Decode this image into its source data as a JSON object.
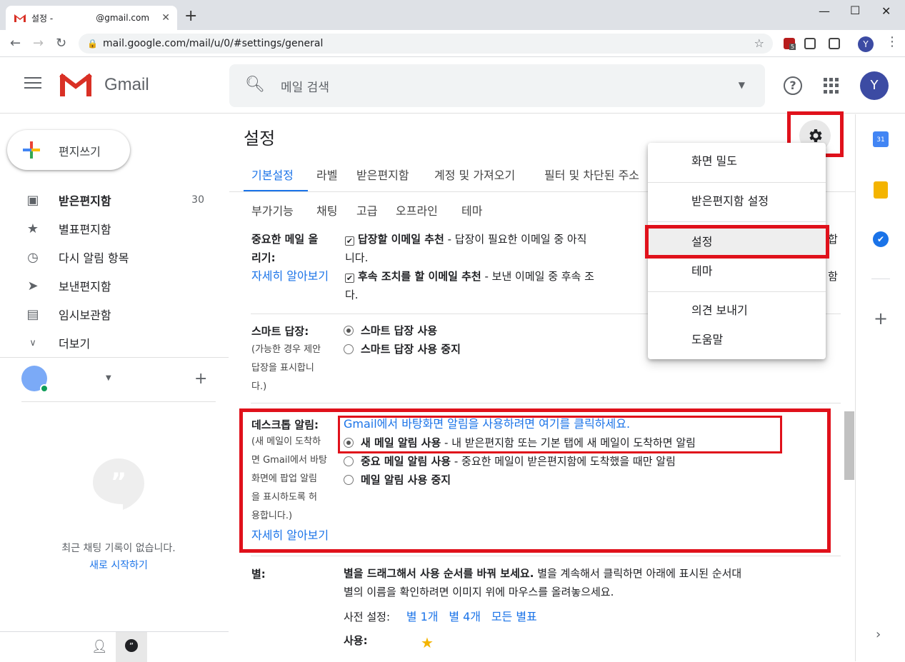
{
  "browser": {
    "tab_title": "설정 -",
    "tab_email": "@gmail.com",
    "url": "mail.google.com/mail/u/0/#settings/general",
    "profile_initial": "Y",
    "ext_badge": "5"
  },
  "gmail": {
    "logo_text": "Gmail",
    "search_placeholder": "메일 검색",
    "avatar_initial": "Y",
    "compose_label": "편지쓰기"
  },
  "sidebar": {
    "items": [
      {
        "label": "받은편지함",
        "count": "30",
        "icon": "inbox-icon",
        "bold": true
      },
      {
        "label": "별표편지함",
        "count": "",
        "icon": "star-icon"
      },
      {
        "label": "다시 알림 항목",
        "count": "",
        "icon": "clock-icon"
      },
      {
        "label": "보낸편지함",
        "count": "",
        "icon": "send-icon"
      },
      {
        "label": "임시보관함",
        "count": "",
        "icon": "draft-icon"
      },
      {
        "label": "더보기",
        "count": "",
        "icon": "chevron-down-icon"
      }
    ],
    "chat_empty": "최근 채팅 기록이 없습니다.",
    "chat_start": "새로 시작하기"
  },
  "settings": {
    "title": "설정",
    "tabs_row1": [
      "기본설정",
      "라벨",
      "받은편지함",
      "계정 및 가져오기",
      "필터 및 차단된 주소"
    ],
    "tabs_row2": [
      "부가기능",
      "채팅",
      "고급",
      "오프라인",
      "테마"
    ],
    "nudge": {
      "label_line1": "중요한 메일 올",
      "label_line2": "리기:",
      "learn_more": "자세히 알아보기",
      "opt1_bold": "답장할 이메일 추천",
      "opt1_rest": " - 답장이 필요한 이메일 중 아직",
      "opt1_tail": "합",
      "opt1_line2": "니다.",
      "opt2_bold": "후속 조치를 할 이메일 추천",
      "opt2_rest": " - 보낸 이메일 중 후속 조",
      "opt2_tail": "함",
      "opt2_line2": "다."
    },
    "smart_reply": {
      "label": "스마트 답장:",
      "desc": [
        "(가능한 경우 제안",
        "답장을 표시합니",
        "다.)"
      ],
      "opt_on": "스마트 답장 사용",
      "opt_off": "스마트 답장 사용 중지"
    },
    "desktop": {
      "label": "데스크톱 알림:",
      "desc": [
        "(새 메일이 도착하",
        "면 Gmail에서 바탕",
        "화면에 팝업 알림",
        "을 표시하도록 허",
        "용합니다.)"
      ],
      "learn_more": "자세히 알아보기",
      "enable_link": "Gmail에서 바탕화면 알림을 사용하려면 여기를 클릭하세요.",
      "opt1_bold": "새 메일 알림 사용",
      "opt1_rest": " - 내 받은편지함 또는 기본 탭에 새 메일이 도착하면 알림",
      "opt2_bold": "중요 메일 알림 사용",
      "opt2_rest": " - 중요한 메일이 받은편지함에 도착했을 때만 알림",
      "opt3_bold": "메일 알림 사용 중지"
    },
    "stars": {
      "label": "별:",
      "line1_bold": "별을 드래그해서 사용 순서를 바꿔 보세요.",
      "line1_rest": "  별을 계속해서 클릭하면 아래에 표시된 순서대",
      "line2": "별의 이름을 확인하려면 이미지 위에 마우스를 올려놓으세요.",
      "presets_label": "사전 설정:",
      "presets": [
        "별 1개",
        "별 4개",
        "모든 별표"
      ],
      "in_use_label": "사용:"
    }
  },
  "gear_menu": {
    "items": [
      "화면 밀도",
      "받은편지함 설정",
      "설정",
      "테마",
      "의견 보내기",
      "도움말"
    ]
  },
  "colors": {
    "accent": "#1a73e8",
    "highlight_red": "#e0111b",
    "gmail_red": "#d93025",
    "star_yellow": "#f4b400"
  }
}
